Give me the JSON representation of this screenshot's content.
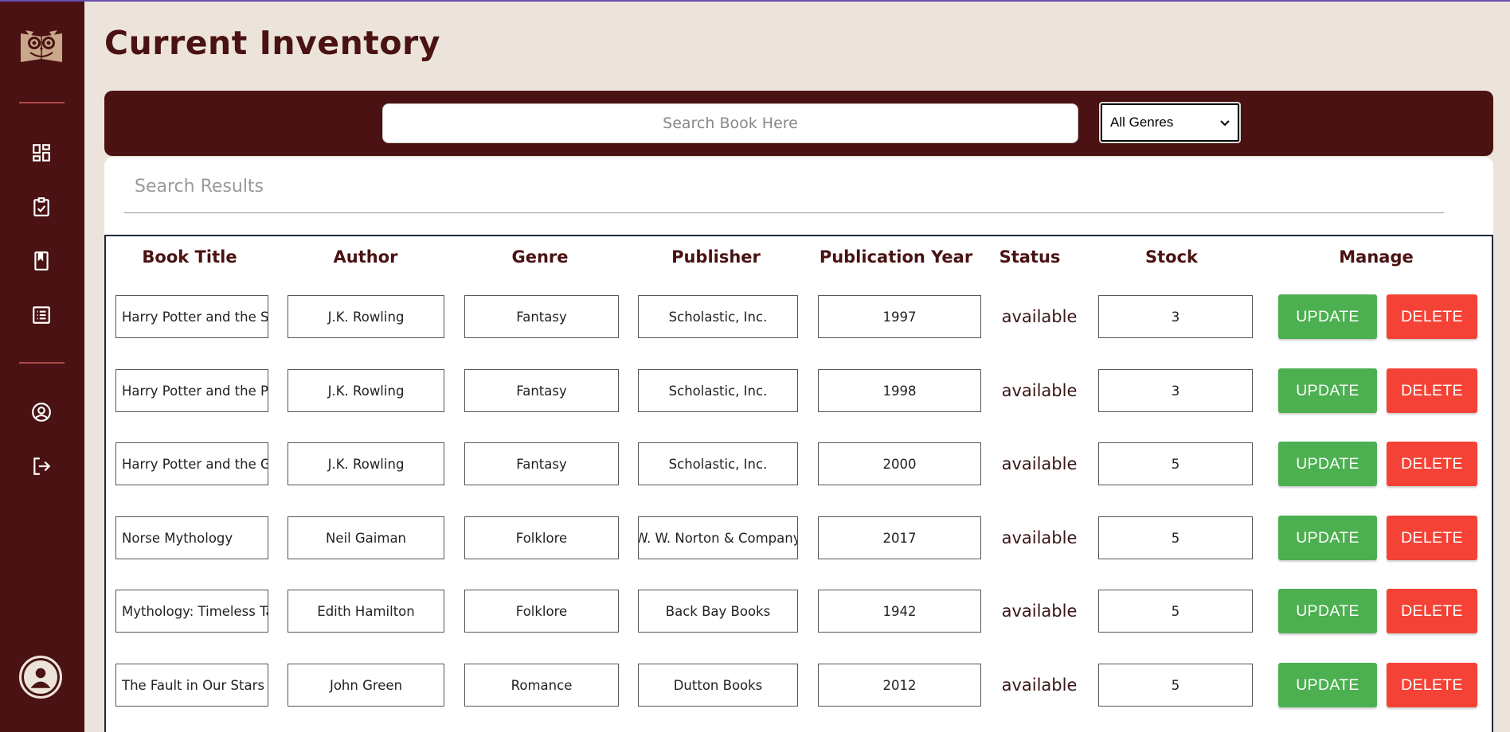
{
  "sidebar": {
    "items": [
      {
        "icon": "dashboard-icon"
      },
      {
        "icon": "clipboard-check-icon"
      },
      {
        "icon": "book-icon"
      },
      {
        "icon": "list-icon"
      },
      {
        "icon": "account-circle-icon"
      },
      {
        "icon": "logout-icon"
      }
    ],
    "brand_color": "#4a1212"
  },
  "page": {
    "title": "Current Inventory"
  },
  "search": {
    "placeholder": "Search Book Here",
    "genre_selected": "All Genres",
    "results_label": "Search Results"
  },
  "table": {
    "headers": {
      "title": "Book Title",
      "author": "Author",
      "genre": "Genre",
      "publisher": "Publisher",
      "year": "Publication Year",
      "status": "Status",
      "stock": "Stock",
      "manage": "Manage"
    },
    "update_label": "UPDATE",
    "delete_label": "DELETE",
    "rows": [
      {
        "title": "Harry Potter and the Sorcerer's Stone",
        "author": "J.K. Rowling",
        "genre": "Fantasy",
        "publisher": "Scholastic, Inc.",
        "year": "1997",
        "status": "available",
        "stock": "3"
      },
      {
        "title": "Harry Potter and the Prisoner of Azkaban",
        "author": "J.K. Rowling",
        "genre": "Fantasy",
        "publisher": "Scholastic, Inc.",
        "year": "1998",
        "status": "available",
        "stock": "3"
      },
      {
        "title": "Harry Potter and the Goblet of Fire",
        "author": "J.K. Rowling",
        "genre": "Fantasy",
        "publisher": "Scholastic, Inc.",
        "year": "2000",
        "status": "available",
        "stock": "5"
      },
      {
        "title": "Norse Mythology",
        "author": "Neil Gaiman",
        "genre": "Folklore",
        "publisher": "W. W. Norton & Company",
        "year": "2017",
        "status": "available",
        "stock": "5"
      },
      {
        "title": "Mythology: Timeless Tales of Gods and Heroes",
        "author": "Edith Hamilton",
        "genre": "Folklore",
        "publisher": "Back Bay Books",
        "year": "1942",
        "status": "available",
        "stock": "5"
      },
      {
        "title": "The Fault in Our Stars",
        "author": "John Green",
        "genre": "Romance",
        "publisher": "Dutton Books",
        "year": "2012",
        "status": "available",
        "stock": "5"
      }
    ]
  },
  "colors": {
    "update": "#4caf50",
    "delete": "#f44336",
    "background": "#ece4da"
  }
}
